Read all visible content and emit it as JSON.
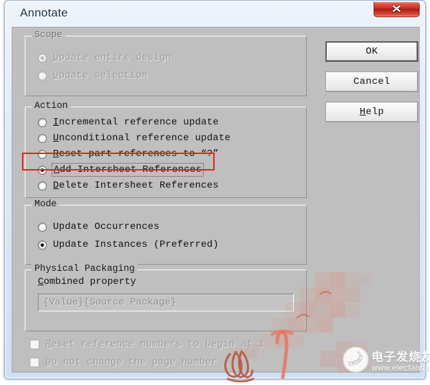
{
  "window": {
    "title": "Annotate",
    "close_label": "✕"
  },
  "scope": {
    "legend": "Scope",
    "options": [
      {
        "label_pre": "",
        "mnemonic": "U",
        "label_post": "pdate entire design",
        "selected": true,
        "enabled": false
      },
      {
        "label_pre": "",
        "mnemonic": "U",
        "label_post": "pdate selection",
        "selected": false,
        "enabled": false
      }
    ]
  },
  "action": {
    "legend": "Action",
    "options": [
      {
        "mnemonic": "I",
        "label_post": "ncremental reference update",
        "selected": false,
        "enabled": true,
        "highlighted": false
      },
      {
        "mnemonic": "U",
        "label_post": "nconditional reference update",
        "selected": false,
        "enabled": true,
        "highlighted": false
      },
      {
        "mnemonic": "R",
        "label_post": "eset part references to “?”",
        "selected": false,
        "enabled": true,
        "highlighted": false
      },
      {
        "mnemonic": "A",
        "label_post": "dd Intersheet References",
        "selected": true,
        "enabled": true,
        "highlighted": true
      },
      {
        "mnemonic": "D",
        "label_post": "elete Intersheet References",
        "selected": false,
        "enabled": true,
        "highlighted": false
      }
    ]
  },
  "mode": {
    "legend": "Mode",
    "options": [
      {
        "mnemonic": "",
        "label_post": "Update Occurrences",
        "selected": false,
        "enabled": true
      },
      {
        "mnemonic": "",
        "label_post": "Update Instances (Preferred)",
        "selected": true,
        "enabled": true
      }
    ]
  },
  "physical_packaging": {
    "legend": "Physical Packaging",
    "field_label_mnemonic": "C",
    "field_label_post": "ombined property",
    "field_value": "{Value}{Source Package}",
    "field_enabled": false
  },
  "bottom_checks": [
    {
      "mnemonic": "R",
      "label_post": "eset reference numbers to begin at 1",
      "checked": false,
      "enabled": false
    },
    {
      "mnemonic": "D",
      "label_post": "o not change the page number",
      "checked": false,
      "enabled": false
    }
  ],
  "buttons": [
    {
      "label": "OK",
      "mnemonic": "",
      "is_default": true
    },
    {
      "label": "Cancel",
      "mnemonic": "",
      "is_default": false
    },
    {
      "label": "Help",
      "mnemonic": "H",
      "is_default": false
    }
  ],
  "watermark": {
    "site_name_cn": "电子发烧友",
    "url": "www.elecfans.com"
  },
  "colors": {
    "highlight_red": "#ee1c1c",
    "dialog_bg": "#bfbfbf",
    "titlebar_top": "#eef4fb",
    "close_red": "#c62b1d",
    "watermark_red": "#e08a76"
  }
}
